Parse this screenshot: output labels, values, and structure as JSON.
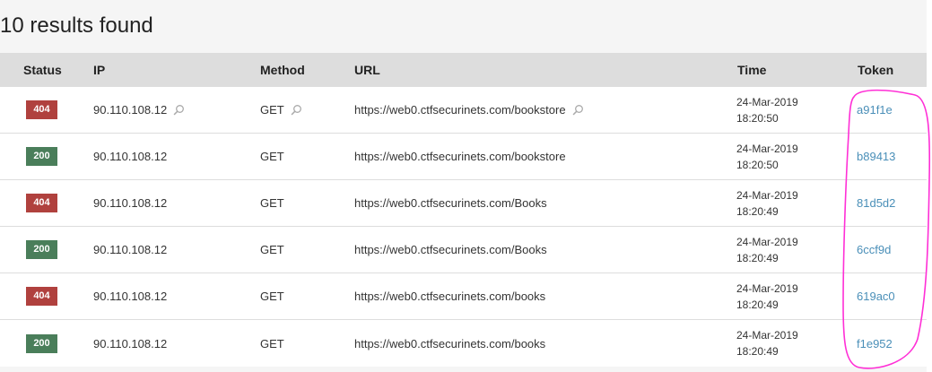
{
  "results": {
    "heading": "10 results found"
  },
  "table": {
    "headers": {
      "status": "Status",
      "ip": "IP",
      "method": "Method",
      "url": "URL",
      "time": "Time",
      "token": "Token"
    },
    "rows": [
      {
        "status": "404",
        "ip": "90.110.108.12",
        "method": "GET",
        "url": "https://web0.ctfsecurinets.com/bookstore",
        "date": "24-Mar-2019",
        "clock": "18:20:50",
        "token": "a91f1e"
      },
      {
        "status": "200",
        "ip": "90.110.108.12",
        "method": "GET",
        "url": "https://web0.ctfsecurinets.com/bookstore",
        "date": "24-Mar-2019",
        "clock": "18:20:50",
        "token": "b89413"
      },
      {
        "status": "404",
        "ip": "90.110.108.12",
        "method": "GET",
        "url": "https://web0.ctfsecurinets.com/Books",
        "date": "24-Mar-2019",
        "clock": "18:20:49",
        "token": "81d5d2"
      },
      {
        "status": "200",
        "ip": "90.110.108.12",
        "method": "GET",
        "url": "https://web0.ctfsecurinets.com/Books",
        "date": "24-Mar-2019",
        "clock": "18:20:49",
        "token": "6ccf9d"
      },
      {
        "status": "404",
        "ip": "90.110.108.12",
        "method": "GET",
        "url": "https://web0.ctfsecurinets.com/books",
        "date": "24-Mar-2019",
        "clock": "18:20:49",
        "token": "619ac0"
      },
      {
        "status": "200",
        "ip": "90.110.108.12",
        "method": "GET",
        "url": "https://web0.ctfsecurinets.com/books",
        "date": "24-Mar-2019",
        "clock": "18:20:49",
        "token": "f1e952"
      }
    ]
  },
  "colors": {
    "status_404": "#b0413e",
    "status_200": "#4a7e5a",
    "token_link": "#4a8fb8",
    "annotation_ink": "#ff2fd6"
  },
  "icons": {
    "filter_hover": "magnifier-icon"
  }
}
